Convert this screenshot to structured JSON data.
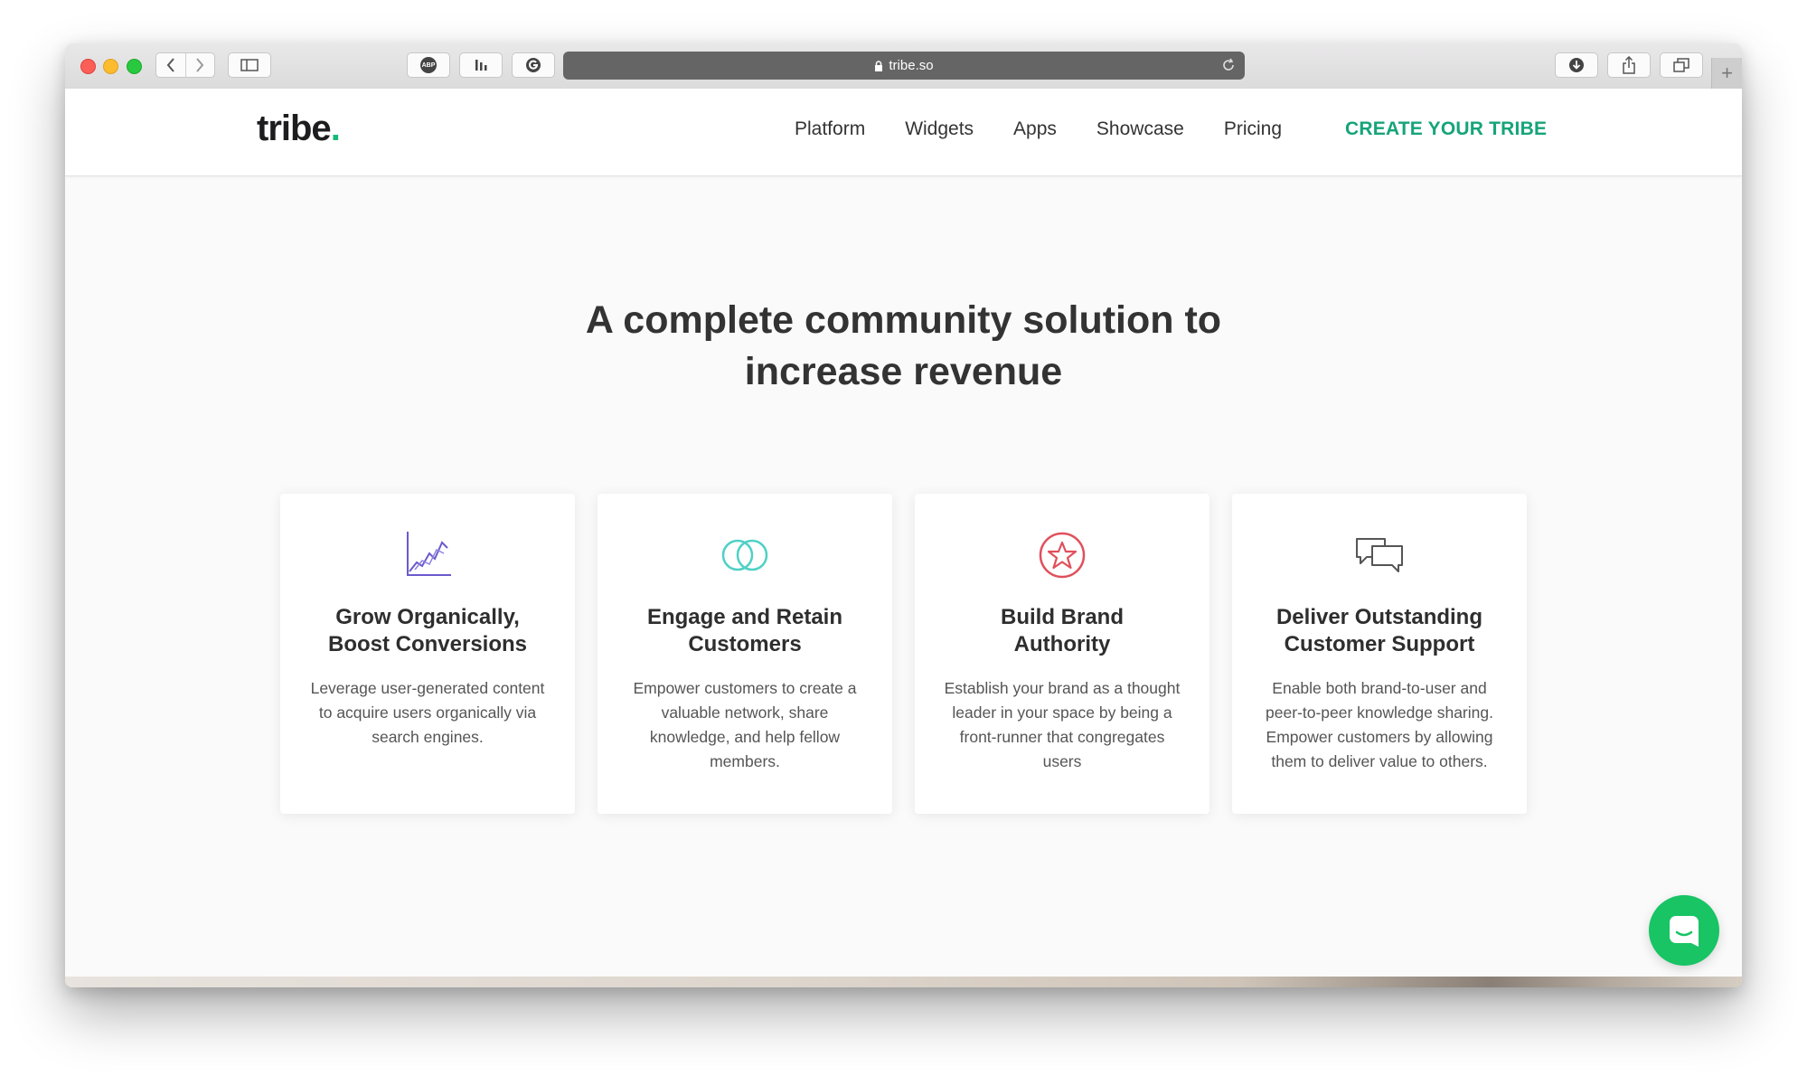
{
  "browser": {
    "url": "tribe.so",
    "toolbar_icons": [
      "back-icon",
      "forward-icon",
      "sidebar-icon",
      "adblock-icon",
      "bars-icon",
      "grammarly-icon",
      "lock-icon",
      "reload-icon",
      "download-icon",
      "share-icon",
      "tabs-icon",
      "plus-icon"
    ],
    "abp_label": "ABP",
    "new_tab": "+"
  },
  "site": {
    "logo": "tribe",
    "logo_dot": ".",
    "nav": {
      "items": [
        "Platform",
        "Widgets",
        "Apps",
        "Showcase",
        "Pricing"
      ],
      "cta": "CREATE YOUR TRIBE"
    },
    "hero": {
      "title_line1": "A complete community solution to",
      "title_line2": "increase revenue"
    },
    "cards": [
      {
        "icon": "growth-chart-icon",
        "title_line1": "Grow Organically,",
        "title_line2": "Boost Conversions",
        "desc": [
          "Leverage user-generated content",
          "to acquire users organically via",
          "search engines."
        ]
      },
      {
        "icon": "interlocking-rings-icon",
        "title_line1": "Engage and Retain",
        "title_line2": "Customers",
        "desc": [
          "Empower customers to create a",
          "valuable network, share",
          "knowledge, and help fellow",
          "members."
        ]
      },
      {
        "icon": "star-badge-icon",
        "title_line1": "Build Brand",
        "title_line2": "Authority",
        "desc": [
          "Establish your brand as a thought",
          "leader in your space by being a",
          "front-runner that congregates",
          "users"
        ]
      },
      {
        "icon": "chat-bubbles-icon",
        "title_line1": "Deliver Outstanding",
        "title_line2": "Customer Support",
        "desc": [
          "Enable both brand-to-user and",
          "peer-to-peer knowledge sharing.",
          "Empower customers by allowing",
          "them to deliver value to others."
        ]
      }
    ],
    "chat_icon": "chat-widget-icon"
  },
  "colors": {
    "brand_green": "#16b978",
    "cta_green": "#16a47a",
    "chat_green": "#18c464",
    "icon_purple": "#6a5acd",
    "icon_teal": "#4fd1c5",
    "icon_red": "#e0505c",
    "icon_gray": "#555555"
  }
}
